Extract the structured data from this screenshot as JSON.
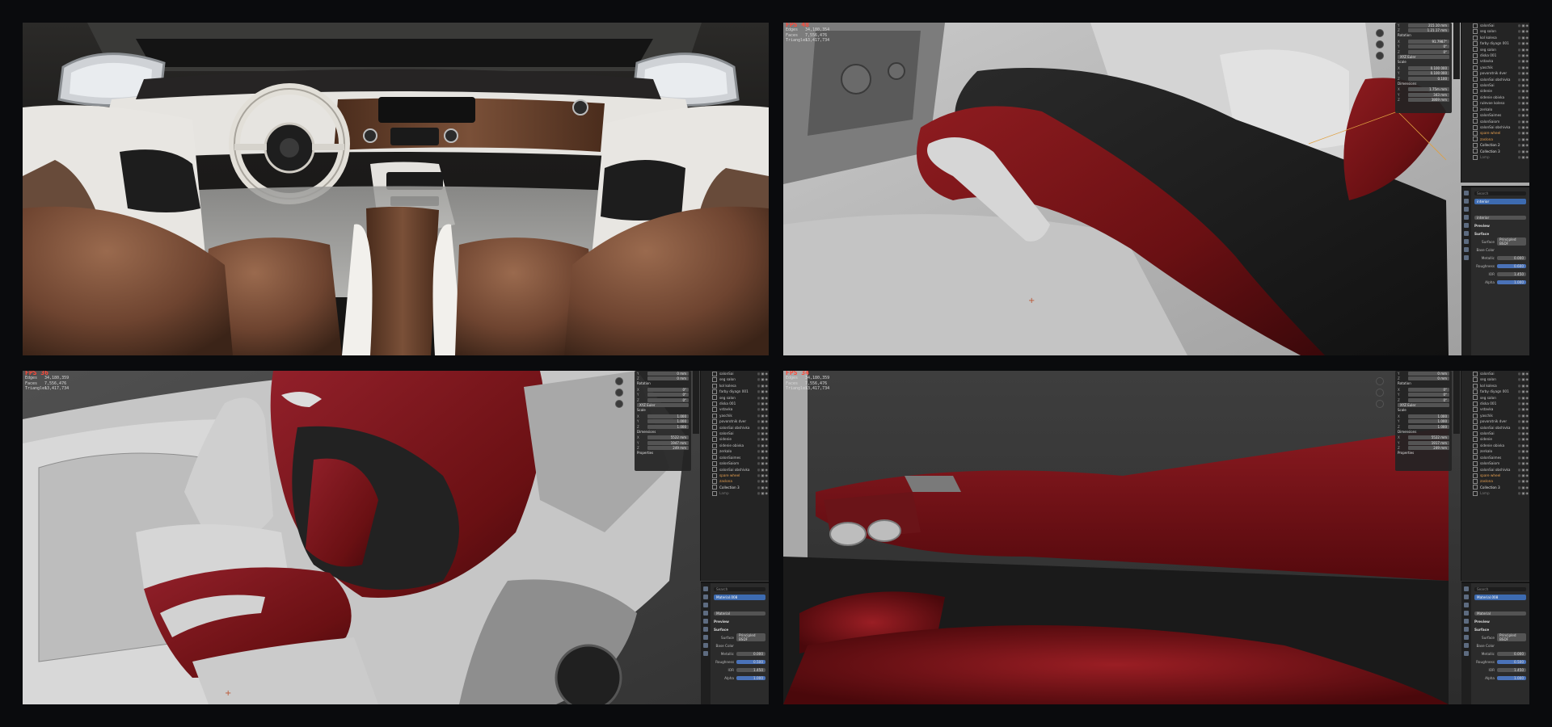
{
  "panels": {
    "top_right": {
      "stats": {
        "fps": "FPS 48",
        "rows": [
          {
            "label": "Edges",
            "value": "34,180,354"
          },
          {
            "label": "Faces",
            "value": "7,556,476"
          },
          {
            "label": "Triangles",
            "value": "13,417,734"
          }
        ]
      },
      "npanel": {
        "rows_top": [
          {
            "k": "Y",
            "v": "215.10 mm"
          },
          {
            "k": "Z",
            "v": "1.21.17 mm"
          }
        ],
        "rotation_label": "Rotation",
        "rotation": [
          {
            "k": "X",
            "v": "91.7987°"
          },
          {
            "k": "Y",
            "v": "0°"
          },
          {
            "k": "Z",
            "v": "0°"
          }
        ],
        "mode": "XYZ Euler",
        "scale_label": "Scale",
        "scale": [
          {
            "k": "X",
            "v": "0.100 000"
          },
          {
            "k": "Y",
            "v": "0.100 000"
          },
          {
            "k": "Z",
            "v": "0.100"
          }
        ],
        "dimensions_label": "Dimensions",
        "dimensions": [
          {
            "k": "X",
            "v": "1.75m mm"
          },
          {
            "k": "Y",
            "v": "343 mm"
          },
          {
            "k": "Z",
            "v": "3869 mm"
          }
        ]
      },
      "outliner": [
        {
          "name": "salonSai",
          "type": "row"
        },
        {
          "name": "seg salon",
          "type": "row"
        },
        {
          "name": "kol kolesa",
          "type": "row"
        },
        {
          "name": "farby diyagn 001",
          "type": "row"
        },
        {
          "name": "seg salon",
          "type": "row"
        },
        {
          "name": "diska 001",
          "type": "row"
        },
        {
          "name": "vstavka",
          "type": "row"
        },
        {
          "name": "yaschik",
          "type": "row"
        },
        {
          "name": "povorotnik dver",
          "type": "row"
        },
        {
          "name": "salonSai obshivka",
          "type": "row"
        },
        {
          "name": "salonSai",
          "type": "row"
        },
        {
          "name": "sidenie",
          "type": "row"
        },
        {
          "name": "sidenie obivka",
          "type": "row"
        },
        {
          "name": "rulevoe koleso",
          "type": "row"
        },
        {
          "name": "zerkalo",
          "type": "row"
        },
        {
          "name": "salonSaimes",
          "type": "row"
        },
        {
          "name": "salonSaiom",
          "type": "row"
        },
        {
          "name": "salonSai obshivka",
          "type": "row"
        },
        {
          "name": "spare wheel",
          "type": "orange"
        },
        {
          "name": "zaslona",
          "type": "orange"
        },
        {
          "name": "Collection 2",
          "type": "coll"
        },
        {
          "name": "Collection 3",
          "type": "coll"
        },
        {
          "name": "Lamp",
          "type": "dim"
        }
      ],
      "props": {
        "search": "Search",
        "material_slot": "interior",
        "material_name": "interior",
        "preview": "Preview",
        "surface_tab": "Surface",
        "surface_label": "Surface",
        "surface_value": "Principled BSDF",
        "fields": [
          {
            "label": "Base Color",
            "value": "",
            "style": "white"
          },
          {
            "label": "Metallic",
            "value": "0.000",
            "style": "plain"
          },
          {
            "label": "Roughness",
            "value": "0.600",
            "style": "blue"
          },
          {
            "label": "IOR",
            "value": "1.450",
            "style": "plain"
          },
          {
            "label": "Alpha",
            "value": "1.000",
            "style": "blue"
          }
        ]
      }
    },
    "bottom_left": {
      "stats": {
        "fps": "FPS 36",
        "rows": [
          {
            "label": "Edges",
            "value": "34,180,359"
          },
          {
            "label": "Faces",
            "value": "7,556,476"
          },
          {
            "label": "Triangles",
            "value": "13,417,734"
          }
        ]
      },
      "npanel": {
        "rows_top": [
          {
            "k": "Y",
            "v": "0 mm"
          },
          {
            "k": "Z",
            "v": "0 mm"
          }
        ],
        "rotation_label": "Rotation",
        "rotation": [
          {
            "k": "X",
            "v": "0°"
          },
          {
            "k": "Y",
            "v": "0°"
          },
          {
            "k": "Z",
            "v": "0°"
          }
        ],
        "mode": "XYZ Euler",
        "scale_label": "Scale",
        "scale": [
          {
            "k": "X",
            "v": "1.000"
          },
          {
            "k": "Y",
            "v": "1.000"
          },
          {
            "k": "Z",
            "v": "1.000"
          }
        ],
        "dimensions_label": "Dimensions",
        "dimensions": [
          {
            "k": "X",
            "v": "5522 mm"
          },
          {
            "k": "Y",
            "v": "1947 mm"
          },
          {
            "k": "Z",
            "v": "249 mm"
          }
        ],
        "properties": "Properties"
      },
      "outliner": [
        {
          "name": "salonSai",
          "type": "row"
        },
        {
          "name": "seg salon",
          "type": "row"
        },
        {
          "name": "kol kolesa",
          "type": "row"
        },
        {
          "name": "farby diyagn 001",
          "type": "row"
        },
        {
          "name": "seg salon",
          "type": "row"
        },
        {
          "name": "diska 001",
          "type": "row"
        },
        {
          "name": "vstavka",
          "type": "row"
        },
        {
          "name": "yaschik",
          "type": "row"
        },
        {
          "name": "povorotnik dver",
          "type": "row"
        },
        {
          "name": "salonSai obshivka",
          "type": "row"
        },
        {
          "name": "salonSai",
          "type": "row"
        },
        {
          "name": "sidenie",
          "type": "row"
        },
        {
          "name": "sidenie obivka",
          "type": "row"
        },
        {
          "name": "zerkalo",
          "type": "row"
        },
        {
          "name": "salonSaimes",
          "type": "row"
        },
        {
          "name": "salonSaiom",
          "type": "row"
        },
        {
          "name": "salonSai obshivka",
          "type": "row"
        },
        {
          "name": "spare wheel",
          "type": "orange"
        },
        {
          "name": "zaslona",
          "type": "orange"
        },
        {
          "name": "Collection 3",
          "type": "coll"
        },
        {
          "name": "Lamp",
          "type": "dim"
        }
      ],
      "props": {
        "search": "Search",
        "material_slot": "Material.008",
        "material_name": "Material",
        "preview": "Preview",
        "surface_tab": "Surface",
        "surface_label": "Surface",
        "surface_value": "Principled BSDF",
        "fields": [
          {
            "label": "Base Color",
            "value": "",
            "style": "white"
          },
          {
            "label": "Metallic",
            "value": "0.000",
            "style": "plain"
          },
          {
            "label": "Roughness",
            "value": "0.500",
            "style": "blue"
          },
          {
            "label": "IOR",
            "value": "1.450",
            "style": "plain"
          },
          {
            "label": "Alpha",
            "value": "1.000",
            "style": "blue"
          }
        ]
      }
    },
    "bottom_right": {
      "stats": {
        "fps": "FPS 34",
        "rows": [
          {
            "label": "Edges",
            "value": "34,180,359"
          },
          {
            "label": "Faces",
            "value": "7,556,476"
          },
          {
            "label": "Triangles",
            "value": "13,417,734"
          }
        ]
      },
      "npanel": {
        "rows_top": [
          {
            "k": "Y",
            "v": "0 mm"
          },
          {
            "k": "Z",
            "v": "0 mm"
          }
        ],
        "rotation_label": "Rotation",
        "rotation": [
          {
            "k": "X",
            "v": "0°"
          },
          {
            "k": "Y",
            "v": "0°"
          },
          {
            "k": "Z",
            "v": "0°"
          }
        ],
        "mode": "XYZ Euler",
        "scale_label": "Scale",
        "scale": [
          {
            "k": "X",
            "v": "1.000"
          },
          {
            "k": "Y",
            "v": "1.000"
          },
          {
            "k": "Z",
            "v": "1.000"
          }
        ],
        "dimensions_label": "Dimensions",
        "dimensions": [
          {
            "k": "X",
            "v": "5522 mm"
          },
          {
            "k": "Y",
            "v": "1917 mm"
          },
          {
            "k": "Z",
            "v": "249 mm"
          }
        ],
        "properties": "Properties"
      },
      "outliner": [
        {
          "name": "salonSai",
          "type": "row"
        },
        {
          "name": "seg salon",
          "type": "row"
        },
        {
          "name": "kol kolesa",
          "type": "row"
        },
        {
          "name": "farby diyagn 001",
          "type": "row"
        },
        {
          "name": "seg salon",
          "type": "row"
        },
        {
          "name": "diska 001",
          "type": "row"
        },
        {
          "name": "vstavka",
          "type": "row"
        },
        {
          "name": "yaschik",
          "type": "row"
        },
        {
          "name": "povorotnik dver",
          "type": "row"
        },
        {
          "name": "salonSai obshivka",
          "type": "row"
        },
        {
          "name": "salonSai",
          "type": "row"
        },
        {
          "name": "sidenie",
          "type": "row"
        },
        {
          "name": "sidenie obivka",
          "type": "row"
        },
        {
          "name": "zerkalo",
          "type": "row"
        },
        {
          "name": "salonSaimes",
          "type": "row"
        },
        {
          "name": "salonSaiom",
          "type": "row"
        },
        {
          "name": "salonSai obshivka",
          "type": "row"
        },
        {
          "name": "spare wheel",
          "type": "orange"
        },
        {
          "name": "zaslona",
          "type": "orange"
        },
        {
          "name": "Collection 3",
          "type": "coll"
        },
        {
          "name": "Lamp",
          "type": "dim"
        }
      ],
      "props": {
        "search": "Search",
        "material_slot": "Material.008",
        "material_name": "Material",
        "preview": "Preview",
        "surface_tab": "Surface",
        "surface_label": "Surface",
        "surface_value": "Principled BSDF",
        "fields": [
          {
            "label": "Base Color",
            "value": "",
            "style": "white"
          },
          {
            "label": "Metallic",
            "value": "0.000",
            "style": "plain"
          },
          {
            "label": "Roughness",
            "value": "0.500",
            "style": "blue"
          },
          {
            "label": "IOR",
            "value": "1.450",
            "style": "plain"
          },
          {
            "label": "Alpha",
            "value": "1.000",
            "style": "blue"
          }
        ]
      }
    }
  },
  "colors": {
    "leather_red": "#7a1418",
    "leather_brown": "#6b4430",
    "trim_white": "#e4e2de",
    "wood": "#5b3a28",
    "clay_grey": "#b8b8b8",
    "accent_blue": "#4a72b8",
    "fps_red": "#ff4a3a"
  }
}
